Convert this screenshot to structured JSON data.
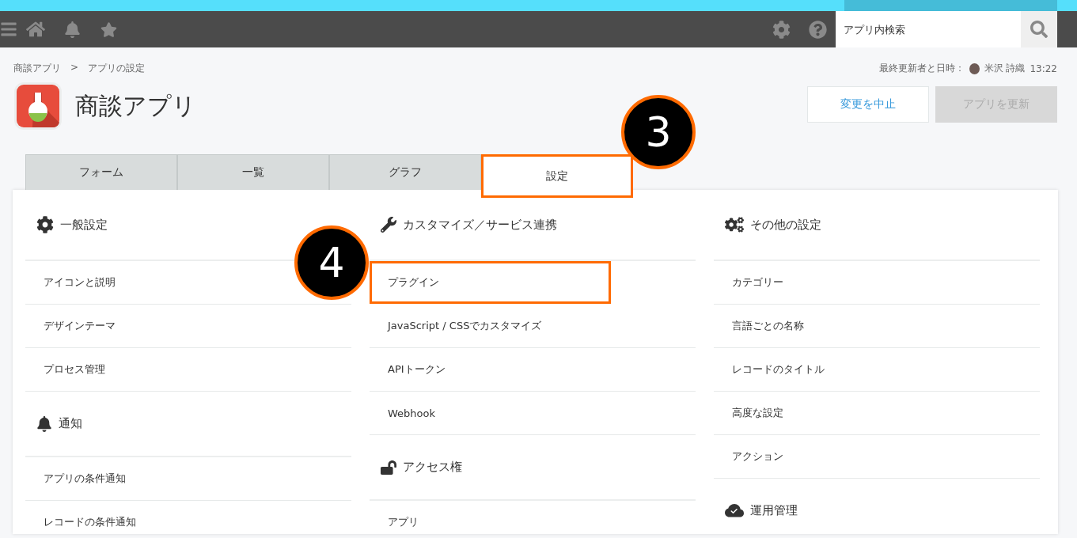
{
  "header": {
    "search": {
      "placeholder": "アプリ内検索"
    }
  },
  "breadcrumb": {
    "items": [
      "商談アプリ",
      "アプリの設定"
    ],
    "separator": ">"
  },
  "last_updated": {
    "label": "最終更新者と日時：",
    "user": "米沢 詩織",
    "time": "13:22"
  },
  "app": {
    "title": "商談アプリ"
  },
  "buttons": [
    {
      "label": "変更を中止",
      "disabled": false
    },
    {
      "label": "アプリを更新",
      "disabled": true
    }
  ],
  "tabs": [
    {
      "label": "フォーム",
      "selected": false,
      "highlighted": false
    },
    {
      "label": "一覧",
      "selected": false,
      "highlighted": false
    },
    {
      "label": "グラフ",
      "selected": false,
      "highlighted": false
    },
    {
      "label": "設定",
      "selected": true,
      "highlighted": true
    }
  ],
  "columns": [
    {
      "sections": [
        {
          "kind": "gear",
          "title": "一般設定",
          "items": [
            {
              "label": "アイコンと説明",
              "highlighted": false
            },
            {
              "label": "デザインテーマ",
              "highlighted": false
            },
            {
              "label": "プロセス管理",
              "highlighted": false
            }
          ]
        },
        {
          "kind": "bell",
          "title": "通知",
          "items": [
            {
              "label": "アプリの条件通知",
              "highlighted": false
            },
            {
              "label": "レコードの条件通知",
              "highlighted": false
            }
          ]
        }
      ]
    },
    {
      "sections": [
        {
          "kind": "wrench",
          "title": "カスタマイズ／サービス連携",
          "items": [
            {
              "label": "プラグイン",
              "highlighted": true
            },
            {
              "label": "JavaScript / CSSでカスタマイズ",
              "highlighted": false
            },
            {
              "label": "APIトークン",
              "highlighted": false
            },
            {
              "label": "Webhook",
              "highlighted": false
            }
          ]
        },
        {
          "kind": "lock",
          "title": "アクセス権",
          "items": [
            {
              "label": "アプリ",
              "highlighted": false
            }
          ]
        }
      ]
    },
    {
      "sections": [
        {
          "kind": "gears",
          "title": "その他の設定",
          "items": [
            {
              "label": "カテゴリー",
              "highlighted": false
            },
            {
              "label": "言語ごとの名称",
              "highlighted": false
            },
            {
              "label": "レコードのタイトル",
              "highlighted": false
            },
            {
              "label": "高度な設定",
              "highlighted": false
            },
            {
              "label": "アクション",
              "highlighted": false
            }
          ]
        },
        {
          "kind": "cloud",
          "title": "運用管理"
        }
      ]
    }
  ],
  "callouts": [
    {
      "label": "3"
    },
    {
      "label": "4"
    }
  ]
}
